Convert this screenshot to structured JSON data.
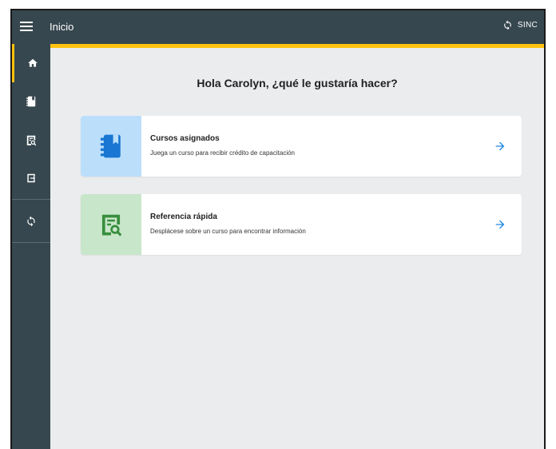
{
  "header": {
    "title": "Inicio",
    "menu_icon": "hamburger-icon",
    "sync_icon": "sync-icon",
    "sync_label": "SINC"
  },
  "colors": {
    "topbar": "#37474f",
    "accent": "#ffc20e",
    "background": "#eaecee",
    "arrow": "#1e88e5",
    "course_icon_bg": "#bbdefb",
    "course_icon": "#1976d2",
    "reference_icon_bg": "#c8e6c9",
    "reference_icon": "#388e3c"
  },
  "sidebar": {
    "items": [
      {
        "icon": "home-icon",
        "active": true
      },
      {
        "icon": "notebook-icon",
        "active": false
      },
      {
        "icon": "reference-search-icon",
        "active": false
      },
      {
        "icon": "exit-icon",
        "active": false
      },
      {
        "icon": "sync-icon",
        "active": false
      }
    ]
  },
  "main": {
    "greeting": "Hola Carolyn, ¿qué le gustaría hacer?",
    "cards": [
      {
        "title": "Cursos asignados",
        "description": "Juega un curso para recibir crédito de capacitación",
        "icon": "notebook-icon"
      },
      {
        "title": "Referencia rápida",
        "description": "Desplácese sobre un curso para encontrar información",
        "icon": "reference-search-icon"
      }
    ]
  }
}
